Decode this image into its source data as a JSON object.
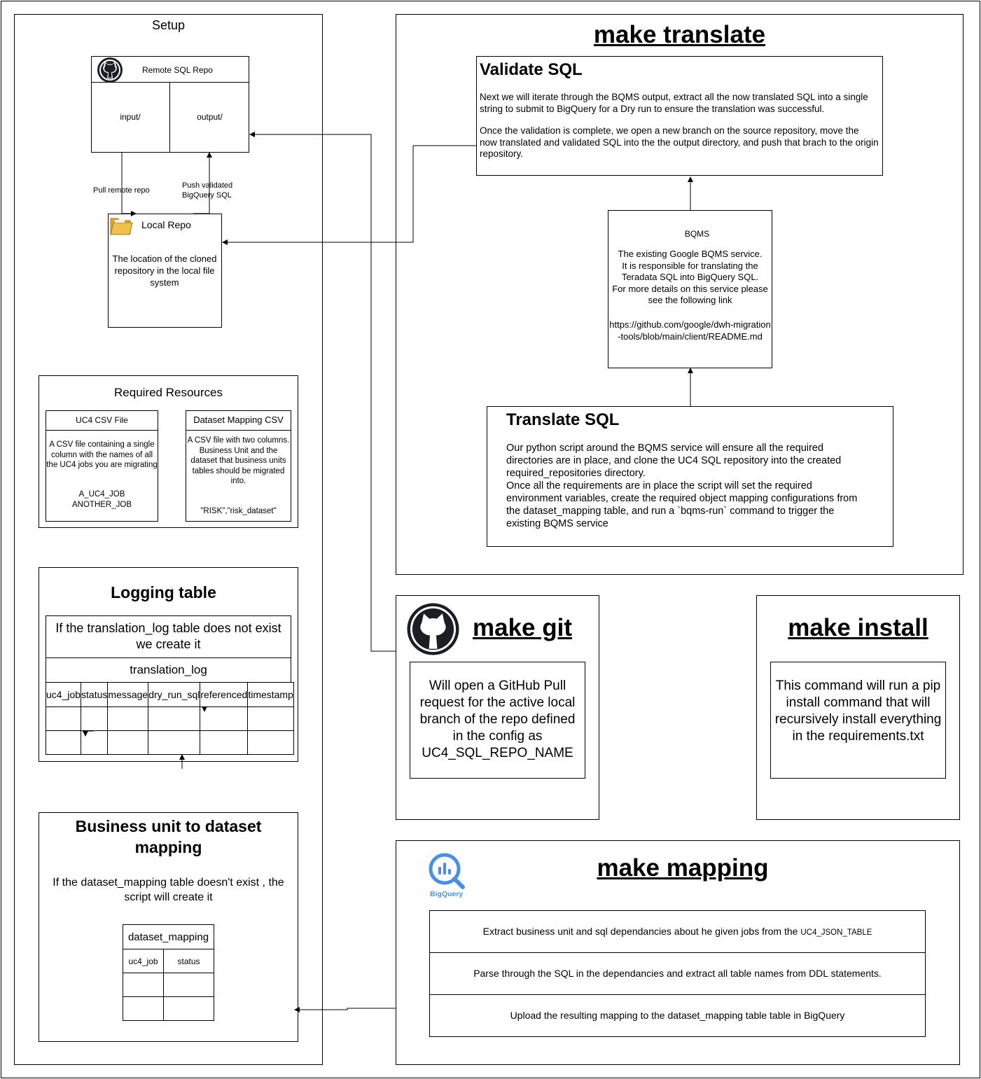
{
  "setup": {
    "title": "Setup",
    "remote_repo": {
      "title": "Remote SQL Repo",
      "input_dir": "input/",
      "output_dir": "output/"
    },
    "pull_label": "Pull remote repo",
    "push_label": "Push validated\n BigQuery SQL",
    "local_repo": {
      "title": "Local Repo",
      "description": "The location of the cloned repository in the local file system"
    },
    "required_resources": {
      "title": "Required Resources",
      "uc4_csv": {
        "title": "UC4 CSV File",
        "description": "A CSV file containing a single column with the names of all the UC4 jobs you are migrating",
        "example": "A_UC4_JOB\nANOTHER_JOB"
      },
      "dataset_csv": {
        "title": "Dataset Mapping CSV",
        "description": "A CSV file with two columns.\nBusiness Unit and the dataset that business units tables should be migrated into.",
        "example": "\"RISK\",\"risk_dataset\""
      }
    },
    "logging_table": {
      "title": "Logging table",
      "note": "If the translation_log table does not exist we create it",
      "table_name": "translation_log",
      "columns": [
        "uc4_job",
        "status",
        "message",
        "dry_run_sql",
        "referenced",
        "timestamp"
      ]
    },
    "business_mapping": {
      "title": "Business unit to dataset mapping",
      "note": "If the dataset_mapping table doesn't exist , the script will create it",
      "table_name": "dataset_mapping",
      "columns": [
        "uc4_job",
        "status"
      ]
    }
  },
  "make_translate": {
    "title": "make translate",
    "validate": {
      "title": "Validate SQL",
      "p1": "Next we will iterate through the BQMS output, extract all the now translated SQL into a single string to submit to BigQuery for a Dry run to ensure the translation was successful.",
      "p2": "Once the validation is complete, we open a new branch on the source repository, move the now translated and validated SQL into the the output directory, and push that brach to the origin repository."
    },
    "bqms": {
      "title": "BQMS",
      "description": "The existing Google BQMS service.\n It is responsible for translating the Teradata SQL into BigQuery SQL.\nFor more details on this service please see the following link",
      "link": "https://github.com/google/dwh-migration-tools/blob/main/client/README.md"
    },
    "translate": {
      "title": "Translate SQL",
      "p1": "Our python script around the BQMS service will ensure all the required directories are in place, and clone the UC4 SQL repository into the created required_repositories directory.",
      "p2": "Once all the requirements are in place the script will set the required environment variables, create the required object mapping configurations from the dataset_mapping table, and run a `bqms-run` command to trigger the existing BQMS service"
    }
  },
  "make_git": {
    "title": "make git",
    "description": "Will open a GitHub Pull request for the active local branch of the repo defined in the config as UC4_SQL_REPO_NAME"
  },
  "make_install": {
    "title": "make install",
    "description": "This command will run a pip install command that will recursively install everything in the requirements.txt"
  },
  "make_mapping": {
    "title": "make mapping",
    "logo_label": "BigQuery",
    "step1": "Extract business unit and sql dependancies about he given jobs from the ",
    "step1_code": "UC4_JSON_TABLE",
    "step2": "Parse through the SQL in the dependancies and extract all table names from DDL statements.",
    "step3": "Upload the resulting mapping to the dataset_mapping table table in BigQuery"
  },
  "icons": [
    "github-icon",
    "folder-icon",
    "bigquery-icon"
  ],
  "colors": {
    "bigquery_blue": "#4a90e2",
    "folder_yellow": "#f0c04a"
  }
}
